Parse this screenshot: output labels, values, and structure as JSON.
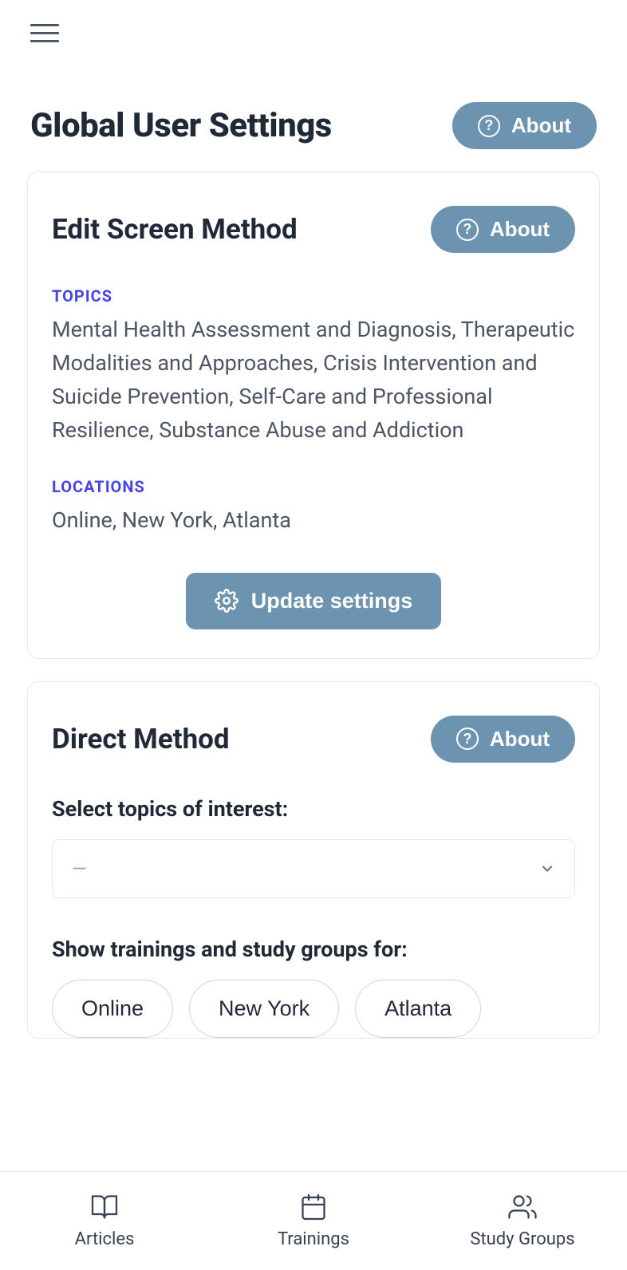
{
  "page_title": "Global User Settings",
  "about_label": "About",
  "card1": {
    "title": "Edit Screen Method",
    "topics_label": "TOPICS",
    "topics_text": "Mental Health Assessment and Diagnosis, Therapeutic Modalities and Approaches, Crisis Intervention and Suicide Prevention, Self-Care and Professional Resilience, Substance Abuse and Addiction",
    "locations_label": "LOCATIONS",
    "locations_text": "Online, New York, Atlanta",
    "update_label": "Update settings"
  },
  "card2": {
    "title": "Direct Method",
    "select_topics_label": "Select topics of interest:",
    "select_placeholder": "—",
    "show_label": "Show trainings and study groups for:",
    "chips": [
      "Online",
      "New York",
      "Atlanta"
    ]
  },
  "nav": {
    "articles": "Articles",
    "trainings": "Trainings",
    "study_groups": "Study Groups"
  }
}
